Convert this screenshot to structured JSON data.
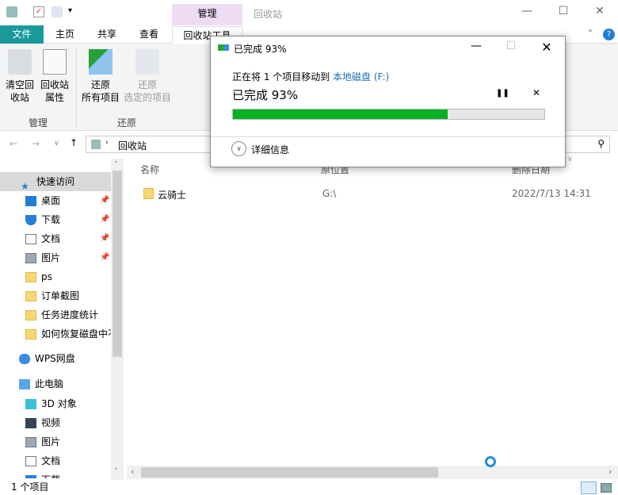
{
  "window": {
    "title": "回收站",
    "context_tab": "管理",
    "min": "—",
    "max": "☐",
    "close": "✕"
  },
  "tabs": [
    "文件",
    "主页",
    "共享",
    "查看",
    "回收站工具"
  ],
  "ribbon": {
    "buttons": [
      {
        "line1": "清空回",
        "line2": "收站",
        "icon": "empty-recycle-bin-icon"
      },
      {
        "line1": "回收站",
        "line2": "属性",
        "icon": "properties-icon"
      },
      {
        "line1": "还原",
        "line2": "所有项目",
        "icon": "restore-all-icon"
      },
      {
        "line1": "还原",
        "line2": "选定的项目",
        "icon": "restore-selected-icon"
      }
    ],
    "groups": [
      "管理",
      "还原"
    ]
  },
  "address": {
    "path": "回收站"
  },
  "columns": [
    "名称",
    "原位置",
    "删除日期"
  ],
  "files": [
    {
      "name": "云骑士",
      "location": "G:\\",
      "deleted": "2022/7/13 14:31"
    }
  ],
  "sidebar": {
    "quick_access": "快速访问",
    "pinned": [
      "桌面",
      "下载",
      "文档",
      "图片"
    ],
    "folders": [
      "ps",
      "订单截图",
      "任务进度统计",
      "如何恢复磁盘中不"
    ],
    "wps": "WPS网盘",
    "pc": "此电脑",
    "pc_items": [
      "3D 对象",
      "视频",
      "图片",
      "文档",
      "下载"
    ]
  },
  "status": {
    "count": "1 个项目"
  },
  "dialog": {
    "title": "已完成 93%",
    "message": "正在将 1 个项目移动到",
    "dest": "本地磁盘 (F:)",
    "progress_text": "已完成 93%",
    "progress_fill": 0.69,
    "details": "详细信息",
    "pause": "❚❚",
    "cancel": "✕",
    "min": "—",
    "max": "☐",
    "close": "✕"
  },
  "colors": {
    "accent": "#1a9a9a",
    "progress": "#06b025",
    "link": "#1f6fb5",
    "context": "#eedcf5"
  }
}
